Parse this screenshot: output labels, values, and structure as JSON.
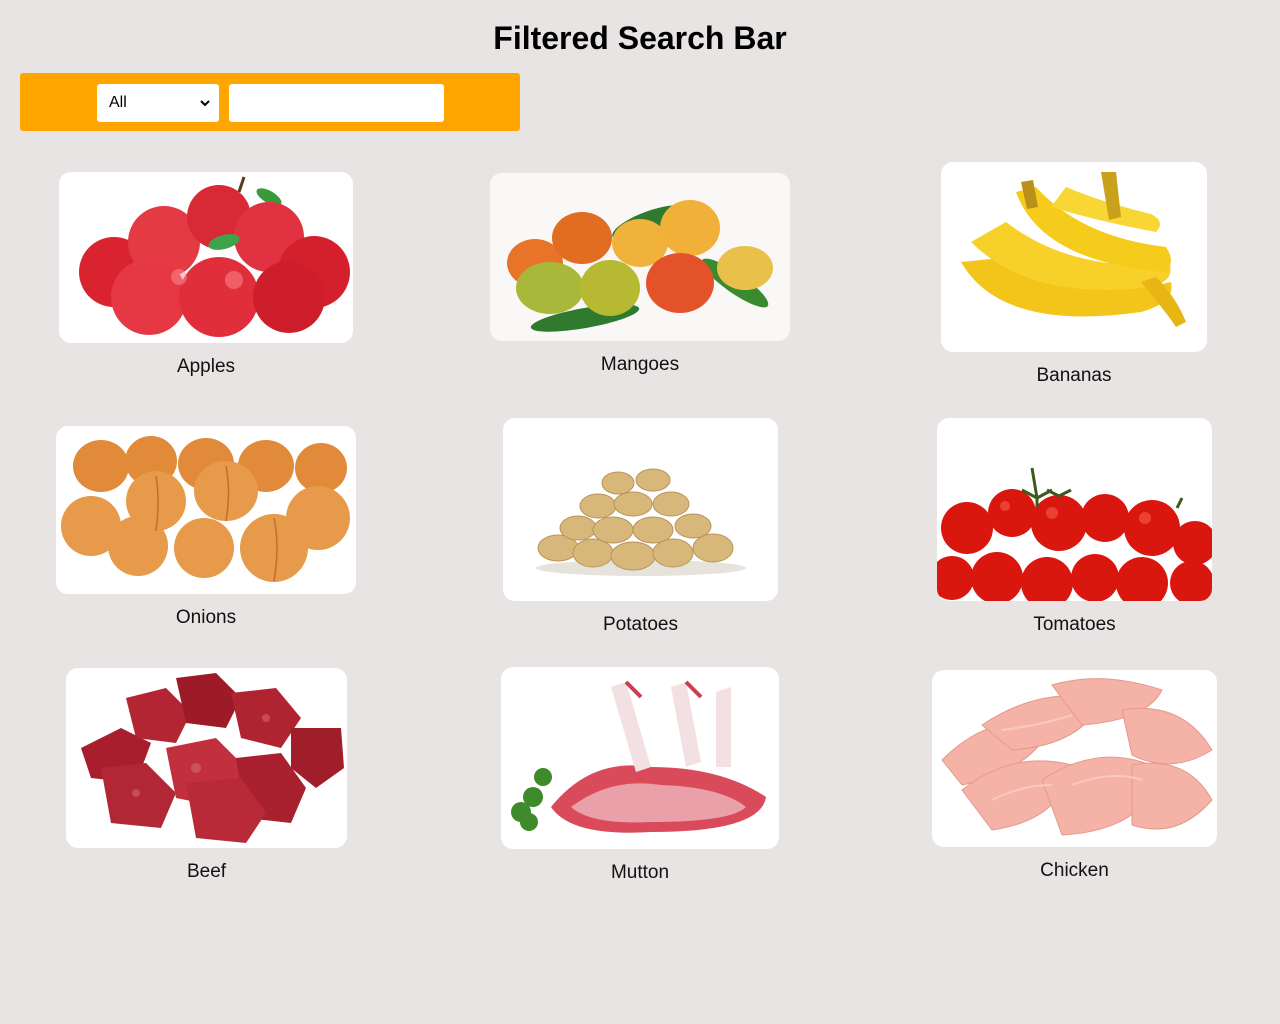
{
  "page": {
    "title": "Filtered Search Bar"
  },
  "filter": {
    "selected_category": "All",
    "search_value": "",
    "bar_color": "#ffa500"
  },
  "products": [
    {
      "name": "Apples"
    },
    {
      "name": "Mangoes"
    },
    {
      "name": "Bananas"
    },
    {
      "name": "Onions"
    },
    {
      "name": "Potatoes"
    },
    {
      "name": "Tomatoes"
    },
    {
      "name": "Beef"
    },
    {
      "name": "Mutton"
    },
    {
      "name": "Chicken"
    }
  ]
}
